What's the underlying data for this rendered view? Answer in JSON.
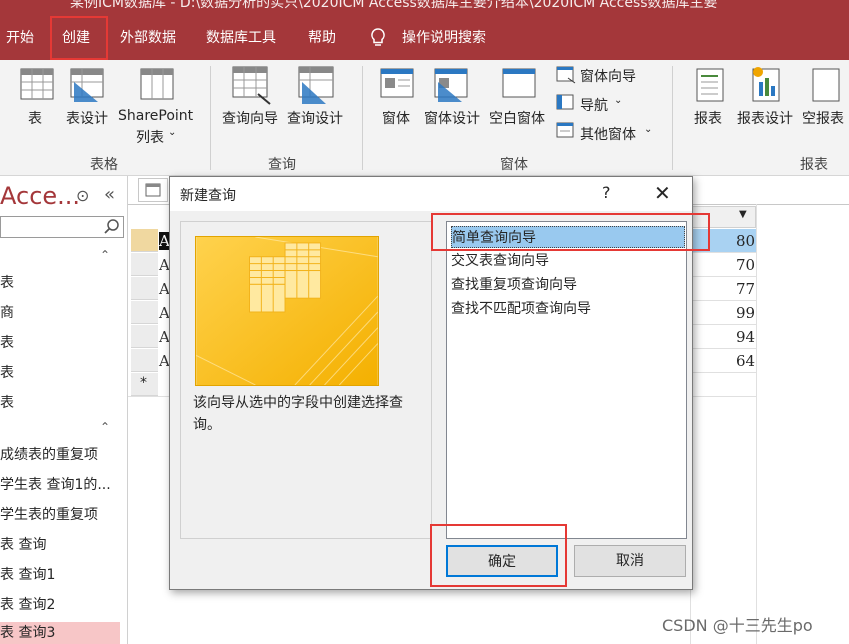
{
  "window_title": "某例ICM数据库 - D:\\数据分析的实只\\2020ICM Access数据库主要介绍本\\2020ICM Access数据库主要",
  "tabs": [
    "开始",
    "创建",
    "外部数据",
    "数据库工具",
    "帮助",
    "操作说明搜索"
  ],
  "active_tab": "创建",
  "ribbon": {
    "groups": [
      {
        "label": "表格",
        "buttons": [
          "表",
          "表设计",
          "SharePoint",
          "列表"
        ]
      },
      {
        "label": "查询",
        "buttons": [
          "查询向导",
          "查询设计"
        ]
      },
      {
        "label": "窗体",
        "buttons": [
          "窗体",
          "窗体设计",
          "空白窗体",
          "窗体向导",
          "导航",
          "其他窗体"
        ]
      },
      {
        "label": "报表",
        "buttons": [
          "报表",
          "报表设计",
          "空报表"
        ]
      }
    ]
  },
  "nav_pane": {
    "title": "Acce...",
    "items": [
      "表",
      "商",
      "表",
      "表",
      "表",
      "成绩表的重复项",
      "学生表 查询1的...",
      "学生表的重复项",
      "表 查询",
      "表 查询1",
      "表 查询2",
      "表 查询3"
    ]
  },
  "datasheet": {
    "row_prefix": "A(",
    "values": [
      "80",
      "70",
      "77",
      "99",
      "94",
      "64"
    ],
    "new_row_marker": "*"
  },
  "dialog": {
    "title": "新建查询",
    "help": "?",
    "close": "✕",
    "description": "该向导从选中的字段中创建选择查询。",
    "options": [
      "简单查询向导",
      "交叉表查询向导",
      "查找重复项查询向导",
      "查找不匹配项查询向导"
    ],
    "selected_index": 0,
    "ok_label": "确定",
    "cancel_label": "取消"
  },
  "watermark": "CSDN @十三先生po",
  "colors": {
    "accent": "#a4373a",
    "highlight": "#e53935",
    "selection": "#99c9ef"
  }
}
